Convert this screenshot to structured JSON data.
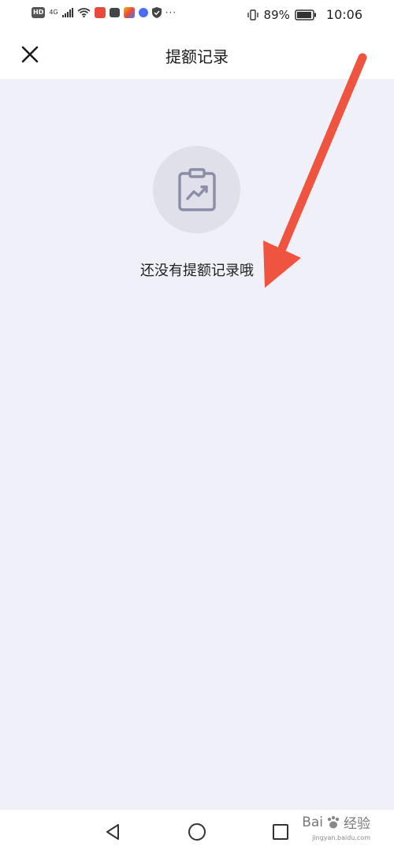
{
  "status_bar": {
    "hd": "HD",
    "network": "4G",
    "dots": "···",
    "battery_percent": "89%",
    "time": "10:06"
  },
  "header": {
    "title": "提额记录",
    "close_icon": "close-icon"
  },
  "empty_state": {
    "icon": "clipboard-chart-icon",
    "message": "还没有提额记录哦"
  },
  "nav_bar": {
    "back_icon": "triangle-back-icon",
    "home_icon": "circle-home-icon",
    "recent_icon": "square-recent-icon"
  },
  "watermark": {
    "brand": "Bai",
    "brand_cn": "经验",
    "domain": "jingyan.baidu.com"
  },
  "colors": {
    "background": "#f0f1f8",
    "icon_circle": "#dfe0ea",
    "icon_stroke": "#8a8da6",
    "annotation_arrow": "#ee5440"
  }
}
